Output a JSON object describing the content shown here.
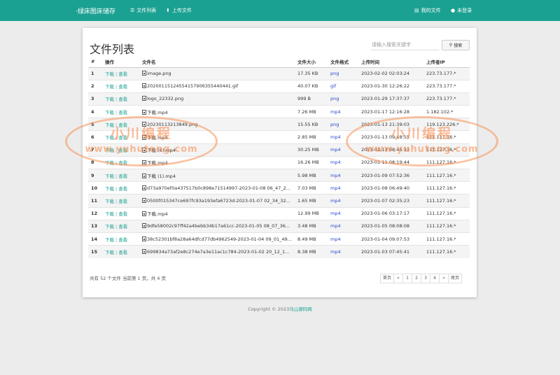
{
  "nav": {
    "brand": "·绿床图床储存",
    "file_list": "文件列表",
    "upload": "上传文件",
    "my_files": "我的文件",
    "login": "未登录"
  },
  "page": {
    "title": "文件列表"
  },
  "search": {
    "placeholder": "请输入搜索关键字",
    "button_label": "搜索"
  },
  "table": {
    "headers": [
      "#",
      "操作",
      "文件名",
      "文件大小",
      "文件格式",
      "上传时间",
      "上传者IP"
    ],
    "download_label": "下载",
    "view_label": "查看",
    "rows": [
      {
        "num": "1",
        "name": "image.png",
        "size": "17.35 KB",
        "format": "png",
        "time": "2023-02-02 02:03:24",
        "ip": "223.73.177.*"
      },
      {
        "num": "2",
        "name": "20200115124554157906355440441.gif",
        "size": "40.07 KB",
        "format": "gif",
        "time": "2023-01-30 12:26:22",
        "ip": "223.73.177.*"
      },
      {
        "num": "3",
        "name": "logo_22332.png",
        "size": "999 B",
        "format": "png",
        "time": "2023-01-29 17:37:37",
        "ip": "223.73.177.*"
      },
      {
        "num": "4",
        "name": "下载.mp4",
        "size": "7.26 MB",
        "format": "mp4",
        "time": "2023-01-17 12:16:28",
        "ip": "1.182.102.*"
      },
      {
        "num": "5",
        "name": "20230113213849.png",
        "size": "15.55 KB",
        "format": "png",
        "time": "2023-01-13 21:39:03",
        "ip": "119.123.226.*"
      },
      {
        "num": "6",
        "name": "下载.mp4",
        "size": "2.85 MB",
        "format": "mp4",
        "time": "2023-01-13 09:48:55",
        "ip": "111.127.16.*"
      },
      {
        "num": "7",
        "name": "下载 (6).mp4",
        "size": "30.25 MB",
        "format": "mp4",
        "time": "2023-01-12 08:45:33",
        "ip": "111.127.16.*"
      },
      {
        "num": "8",
        "name": "下载.mp4",
        "size": "16.26 MB",
        "format": "mp4",
        "time": "2023-01-11 08:19:44",
        "ip": "111.127.16.*"
      },
      {
        "num": "9",
        "name": "下载 (1).mp4",
        "size": "5.98 MB",
        "format": "mp4",
        "time": "2023-01-09 07:52:36",
        "ip": "111.127.16.*"
      },
      {
        "num": "10",
        "name": "d73a970ef0a437517b0c898e71514997-2023-01-08 06_47_26...",
        "size": "7.03 MB",
        "format": "mp4",
        "time": "2023-01-08 06:49:40",
        "ip": "111.127.16.*"
      },
      {
        "num": "11",
        "name": "0500f015347ce697fc93a193efa6723d-2023-01-07 02_34_32...",
        "size": "1.65 MB",
        "format": "mp4",
        "time": "2023-01-07 02:35:23",
        "ip": "111.127.16.*"
      },
      {
        "num": "12",
        "name": "下载.mp4",
        "size": "12.99 MB",
        "format": "mp4",
        "time": "2023-01-06 03:17:17",
        "ip": "111.127.16.*"
      },
      {
        "num": "13",
        "name": "9dfe58002c97ff42a4bebb34b17a61cc-2023-01-05 08_07_36...",
        "size": "3.48 MB",
        "format": "mp4",
        "time": "2023-01-05 08:08:08",
        "ip": "111.127.16.*"
      },
      {
        "num": "14",
        "name": "38c52301bf8a28a64dfcd77db4962549-2023-01-04 09_01_49...",
        "size": "8.49 MB",
        "format": "mp4",
        "time": "2023-01-04 09:07:53",
        "ip": "111.127.16.*"
      },
      {
        "num": "15",
        "name": "699834a73af2e8c274e7a3e11ac1c784-2023-01-02 20_12_16...",
        "size": "8.38 MB",
        "format": "mp4",
        "time": "2023-01-03 07:45:41",
        "ip": "111.127.16.*"
      }
    ]
  },
  "summary": "共有 52 个文件  当前第 1 页，共 4 页",
  "pagination": {
    "first": "首页",
    "prev": "«",
    "pages": [
      "1",
      "2",
      "3",
      "4"
    ],
    "next": "»",
    "last": "尾页"
  },
  "footer": {
    "copyright": "Copyright © 2023",
    "link_text": "马山源码网"
  },
  "watermark": {
    "line1": "小川编程",
    "line2": "www.yuhuteng.com",
    "color": "#f6945a"
  },
  "colors": {
    "brand": "#1ba192",
    "format_link": "#2a47c8"
  }
}
